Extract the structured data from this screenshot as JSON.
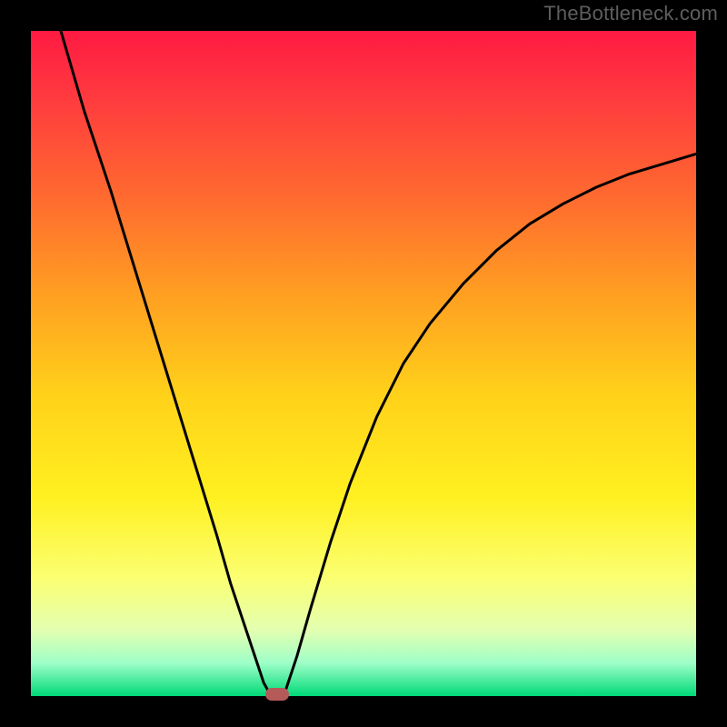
{
  "watermark": {
    "text": "TheBottleneck.com"
  },
  "colors": {
    "background": "#000000",
    "gradient_top": "#ff1a42",
    "gradient_mid": "#ffd21a",
    "gradient_bottom": "#00d977",
    "curve": "#000000",
    "marker": "#b45a59"
  },
  "chart_data": {
    "type": "line",
    "title": "",
    "xlabel": "",
    "ylabel": "",
    "xlim": [
      0,
      100
    ],
    "ylim": [
      0,
      100
    ],
    "grid": false,
    "series": [
      {
        "name": "left-branch",
        "x": [
          4.5,
          8,
          12,
          16,
          20,
          24,
          28,
          30,
          32,
          34,
          35,
          36,
          36.5
        ],
        "y": [
          100,
          88,
          76,
          63,
          50,
          37,
          24,
          17,
          11,
          5,
          2,
          0.2,
          0
        ]
      },
      {
        "name": "right-branch",
        "x": [
          38,
          40,
          42,
          45,
          48,
          52,
          56,
          60,
          65,
          70,
          75,
          80,
          85,
          90,
          95,
          100
        ],
        "y": [
          0,
          6,
          13,
          23,
          32,
          42,
          50,
          56,
          62,
          67,
          71,
          74,
          76.5,
          78.5,
          80,
          81.5
        ]
      }
    ],
    "marker": {
      "x": 37,
      "y": 0
    },
    "legend": false
  }
}
